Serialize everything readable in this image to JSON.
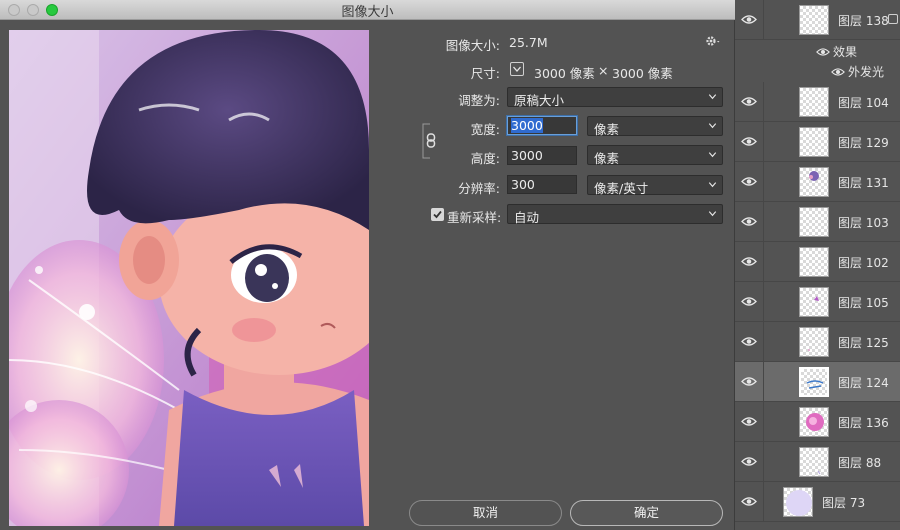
{
  "window": {
    "title": "图像大小"
  },
  "dialog": {
    "image_size_label": "图像大小:",
    "image_size_value": "25.7M",
    "dimensions_label": "尺寸:",
    "dimensions_width": "3000 像素",
    "dimensions_sep": "×",
    "dimensions_height": "3000 像素",
    "fit_to_label": "调整为:",
    "fit_to_value": "原稿大小",
    "width_label": "宽度:",
    "width_value": "3000",
    "width_unit": "像素",
    "height_label": "高度:",
    "height_value": "3000",
    "height_unit": "像素",
    "resolution_label": "分辨率:",
    "resolution_value": "300",
    "resolution_unit": "像素/英寸",
    "resample_label": "重新采样:",
    "resample_checked": true,
    "resample_value": "自动",
    "cancel_label": "取消",
    "ok_label": "确定"
  },
  "layers": {
    "items": [
      {
        "name": "图层 138",
        "selected": false
      },
      {
        "name": "图层 104",
        "selected": false
      },
      {
        "name": "图层 129",
        "selected": false
      },
      {
        "name": "图层 131",
        "selected": false
      },
      {
        "name": "图层 103",
        "selected": false
      },
      {
        "name": "图层 102",
        "selected": false
      },
      {
        "name": "图层 105",
        "selected": false
      },
      {
        "name": "图层 125",
        "selected": false
      },
      {
        "name": "图层 124",
        "selected": true
      },
      {
        "name": "图层 136",
        "selected": false
      },
      {
        "name": "图层 88",
        "selected": false
      },
      {
        "name": "图层 73",
        "selected": false
      }
    ],
    "effects_label": "效果",
    "outer_glow_label": "外发光"
  },
  "colors": {
    "panel_bg": "#535353",
    "field_bg": "#3f3f3f",
    "selection": "#2f6bd0",
    "zoom_green": "#27c93f",
    "selected_layer": "#6b6b6b"
  }
}
